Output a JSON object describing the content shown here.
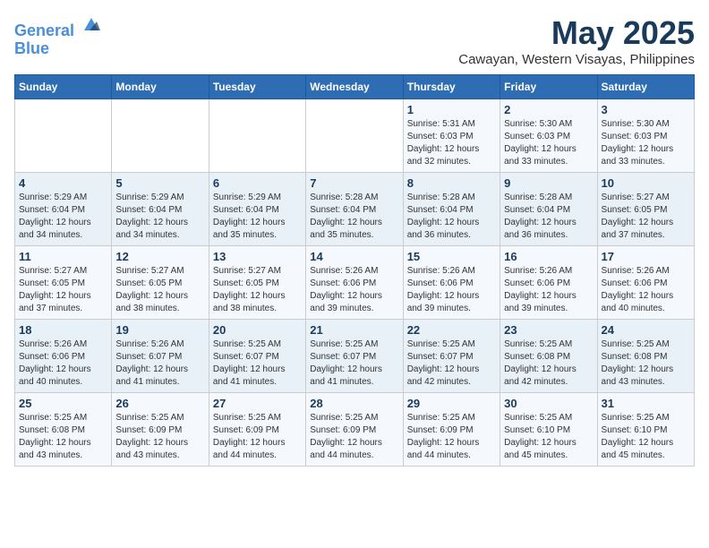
{
  "header": {
    "logo_line1": "General",
    "logo_line2": "Blue",
    "month_title": "May 2025",
    "location": "Cawayan, Western Visayas, Philippines"
  },
  "days_of_week": [
    "Sunday",
    "Monday",
    "Tuesday",
    "Wednesday",
    "Thursday",
    "Friday",
    "Saturday"
  ],
  "weeks": [
    [
      {
        "day": "",
        "info": ""
      },
      {
        "day": "",
        "info": ""
      },
      {
        "day": "",
        "info": ""
      },
      {
        "day": "",
        "info": ""
      },
      {
        "day": "1",
        "info": "Sunrise: 5:31 AM\nSunset: 6:03 PM\nDaylight: 12 hours\nand 32 minutes."
      },
      {
        "day": "2",
        "info": "Sunrise: 5:30 AM\nSunset: 6:03 PM\nDaylight: 12 hours\nand 33 minutes."
      },
      {
        "day": "3",
        "info": "Sunrise: 5:30 AM\nSunset: 6:03 PM\nDaylight: 12 hours\nand 33 minutes."
      }
    ],
    [
      {
        "day": "4",
        "info": "Sunrise: 5:29 AM\nSunset: 6:04 PM\nDaylight: 12 hours\nand 34 minutes."
      },
      {
        "day": "5",
        "info": "Sunrise: 5:29 AM\nSunset: 6:04 PM\nDaylight: 12 hours\nand 34 minutes."
      },
      {
        "day": "6",
        "info": "Sunrise: 5:29 AM\nSunset: 6:04 PM\nDaylight: 12 hours\nand 35 minutes."
      },
      {
        "day": "7",
        "info": "Sunrise: 5:28 AM\nSunset: 6:04 PM\nDaylight: 12 hours\nand 35 minutes."
      },
      {
        "day": "8",
        "info": "Sunrise: 5:28 AM\nSunset: 6:04 PM\nDaylight: 12 hours\nand 36 minutes."
      },
      {
        "day": "9",
        "info": "Sunrise: 5:28 AM\nSunset: 6:04 PM\nDaylight: 12 hours\nand 36 minutes."
      },
      {
        "day": "10",
        "info": "Sunrise: 5:27 AM\nSunset: 6:05 PM\nDaylight: 12 hours\nand 37 minutes."
      }
    ],
    [
      {
        "day": "11",
        "info": "Sunrise: 5:27 AM\nSunset: 6:05 PM\nDaylight: 12 hours\nand 37 minutes."
      },
      {
        "day": "12",
        "info": "Sunrise: 5:27 AM\nSunset: 6:05 PM\nDaylight: 12 hours\nand 38 minutes."
      },
      {
        "day": "13",
        "info": "Sunrise: 5:27 AM\nSunset: 6:05 PM\nDaylight: 12 hours\nand 38 minutes."
      },
      {
        "day": "14",
        "info": "Sunrise: 5:26 AM\nSunset: 6:06 PM\nDaylight: 12 hours\nand 39 minutes."
      },
      {
        "day": "15",
        "info": "Sunrise: 5:26 AM\nSunset: 6:06 PM\nDaylight: 12 hours\nand 39 minutes."
      },
      {
        "day": "16",
        "info": "Sunrise: 5:26 AM\nSunset: 6:06 PM\nDaylight: 12 hours\nand 39 minutes."
      },
      {
        "day": "17",
        "info": "Sunrise: 5:26 AM\nSunset: 6:06 PM\nDaylight: 12 hours\nand 40 minutes."
      }
    ],
    [
      {
        "day": "18",
        "info": "Sunrise: 5:26 AM\nSunset: 6:06 PM\nDaylight: 12 hours\nand 40 minutes."
      },
      {
        "day": "19",
        "info": "Sunrise: 5:26 AM\nSunset: 6:07 PM\nDaylight: 12 hours\nand 41 minutes."
      },
      {
        "day": "20",
        "info": "Sunrise: 5:25 AM\nSunset: 6:07 PM\nDaylight: 12 hours\nand 41 minutes."
      },
      {
        "day": "21",
        "info": "Sunrise: 5:25 AM\nSunset: 6:07 PM\nDaylight: 12 hours\nand 41 minutes."
      },
      {
        "day": "22",
        "info": "Sunrise: 5:25 AM\nSunset: 6:07 PM\nDaylight: 12 hours\nand 42 minutes."
      },
      {
        "day": "23",
        "info": "Sunrise: 5:25 AM\nSunset: 6:08 PM\nDaylight: 12 hours\nand 42 minutes."
      },
      {
        "day": "24",
        "info": "Sunrise: 5:25 AM\nSunset: 6:08 PM\nDaylight: 12 hours\nand 43 minutes."
      }
    ],
    [
      {
        "day": "25",
        "info": "Sunrise: 5:25 AM\nSunset: 6:08 PM\nDaylight: 12 hours\nand 43 minutes."
      },
      {
        "day": "26",
        "info": "Sunrise: 5:25 AM\nSunset: 6:09 PM\nDaylight: 12 hours\nand 43 minutes."
      },
      {
        "day": "27",
        "info": "Sunrise: 5:25 AM\nSunset: 6:09 PM\nDaylight: 12 hours\nand 44 minutes."
      },
      {
        "day": "28",
        "info": "Sunrise: 5:25 AM\nSunset: 6:09 PM\nDaylight: 12 hours\nand 44 minutes."
      },
      {
        "day": "29",
        "info": "Sunrise: 5:25 AM\nSunset: 6:09 PM\nDaylight: 12 hours\nand 44 minutes."
      },
      {
        "day": "30",
        "info": "Sunrise: 5:25 AM\nSunset: 6:10 PM\nDaylight: 12 hours\nand 45 minutes."
      },
      {
        "day": "31",
        "info": "Sunrise: 5:25 AM\nSunset: 6:10 PM\nDaylight: 12 hours\nand 45 minutes."
      }
    ]
  ]
}
